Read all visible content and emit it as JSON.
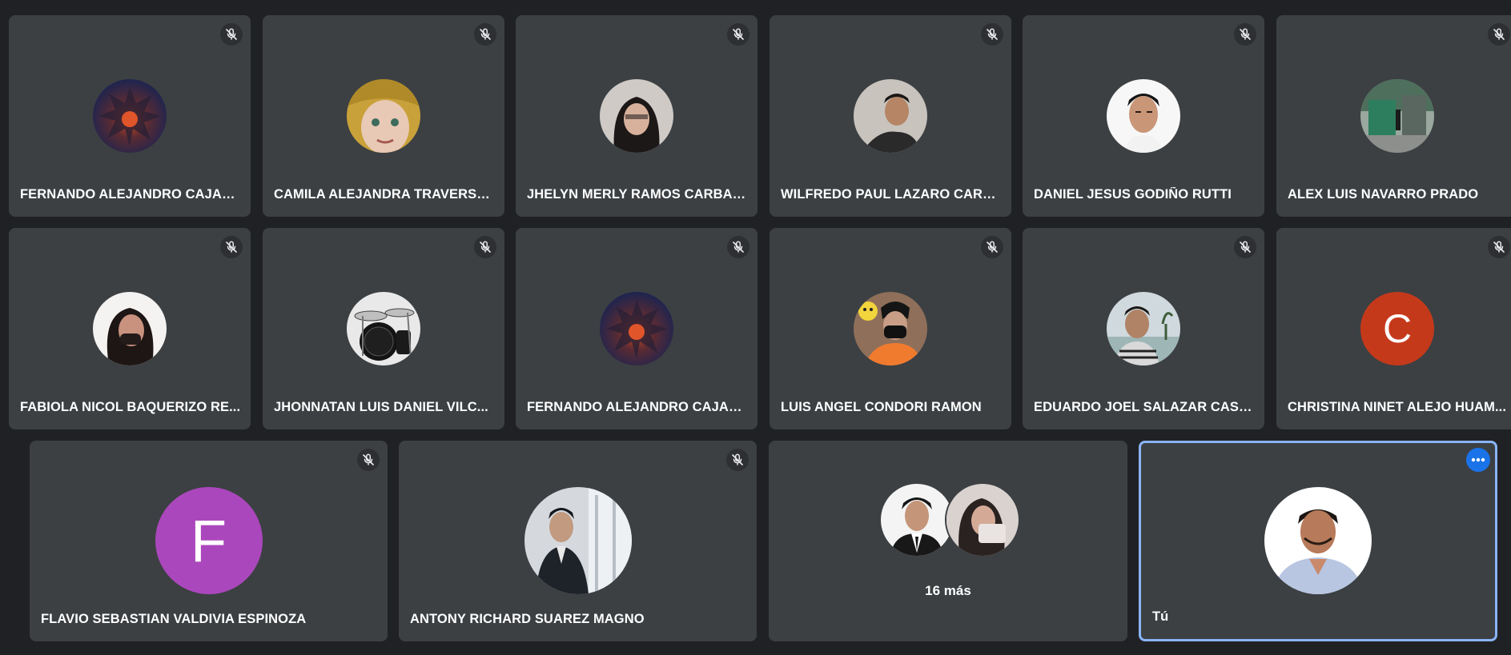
{
  "participants_row1": [
    {
      "name": "FERNANDO ALEJANDRO CAJAH...",
      "avatar": "spiky-dragon-photo"
    },
    {
      "name": "CAMILA ALEJANDRA TRAVERSO...",
      "avatar": "girl-selfie-photo"
    },
    {
      "name": "JHELYN MERLY RAMOS CARBAJ...",
      "avatar": "girl-photo"
    },
    {
      "name": "WILFREDO PAUL LAZARO CARPI...",
      "avatar": "boy-selfie-photo"
    },
    {
      "name": "DANIEL JESUS GODIÑO RUTTI",
      "avatar": "boy-portrait-photo"
    },
    {
      "name": "ALEX LUIS NAVARRO PRADO",
      "avatar": "landscape-photo"
    }
  ],
  "participants_row2": [
    {
      "name": "FABIOLA NICOL BAQUERIZO RE...",
      "avatar": "girl-photo"
    },
    {
      "name": "JHONNATAN LUIS DANIEL VILC...",
      "avatar": "drum-kit-photo"
    },
    {
      "name": "FERNANDO ALEJANDRO CAJAH...",
      "avatar": "spiky-dragon-photo"
    },
    {
      "name": "LUIS ANGEL CONDORI RAMON",
      "avatar": "boy-mask-photo"
    },
    {
      "name": "EDUARDO JOEL SALAZAR CASTI...",
      "avatar": "boy-beach-photo"
    },
    {
      "name": "CHRISTINA NINET ALEJO HUAM...",
      "avatar_letter": "C",
      "avatar_color": "#c5391b"
    }
  ],
  "participants_row3": [
    {
      "name": "FLAVIO SEBASTIAN VALDIVIA ESPINOZA",
      "avatar_letter": "F",
      "avatar_color": "#ab47bc"
    },
    {
      "name": "ANTONY RICHARD SUAREZ MAGNO",
      "avatar": "man-suit-photo"
    }
  ],
  "others_tile": {
    "label": "16 más"
  },
  "self_tile": {
    "name": "Tú",
    "avatar": "man-portrait-photo"
  },
  "colors": {
    "background": "#202124",
    "tile": "#3c4043",
    "self_border": "#8ab4f8",
    "accent": "#1a73e8"
  },
  "icons": {
    "muted": "mic-off-icon",
    "more": "more-options-icon"
  }
}
